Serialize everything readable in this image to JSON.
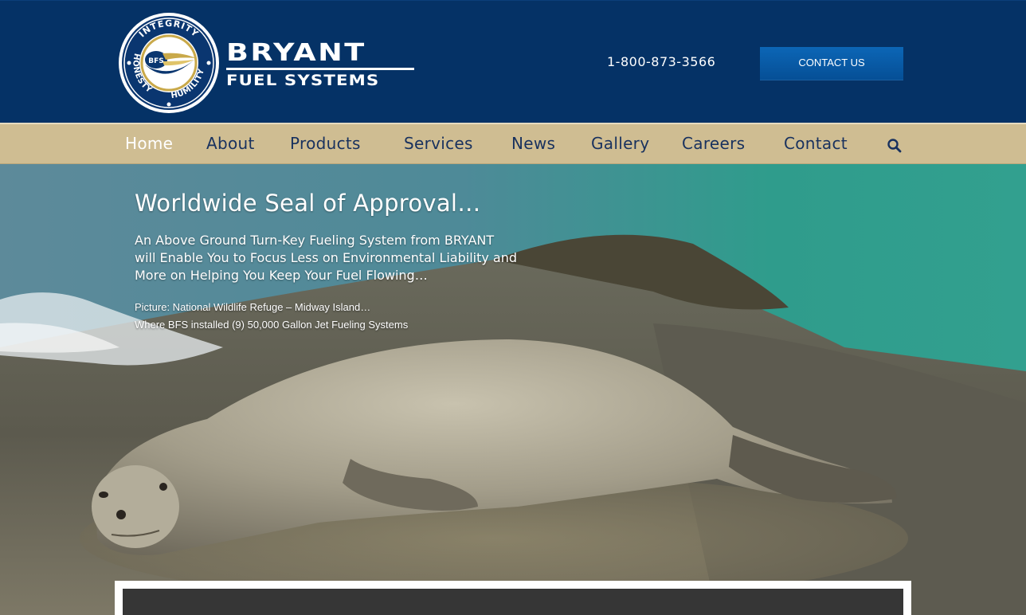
{
  "header": {
    "logo": {
      "seal_words": [
        "INTEGRITY",
        "HONESTY",
        "HUMILITY"
      ],
      "seal_center": "BFS",
      "title": "BRYANT",
      "subtitle": "FUEL SYSTEMS"
    },
    "phone": "1-800-873-3566",
    "contact_button": "CONTACT US"
  },
  "nav": {
    "items": [
      {
        "label": "Home",
        "active": true
      },
      {
        "label": "About"
      },
      {
        "label": "Products"
      },
      {
        "label": "Services"
      },
      {
        "label": "News"
      },
      {
        "label": "Gallery"
      },
      {
        "label": "Careers"
      },
      {
        "label": "Contact"
      }
    ],
    "search_icon": "search-icon"
  },
  "hero": {
    "title": "Worldwide Seal of Approval…",
    "subtitle_lines": [
      "An Above Ground Turn-Key Fueling System from BRYANT",
      "will Enable You to Focus Less on Environmental Liability and",
      "More on Helping You Keep Your Fuel Flowing…"
    ],
    "caption_lines": [
      "Picture: National Wildlife Refuge – Midway Island…",
      "Where BFS installed (9) 50,000 Gallon Jet Fueling Systems"
    ]
  },
  "colors": {
    "header_bg": "#053266",
    "nav_bg": "#cfbd92",
    "nav_text": "#18315e",
    "button": "#0a5eab"
  }
}
